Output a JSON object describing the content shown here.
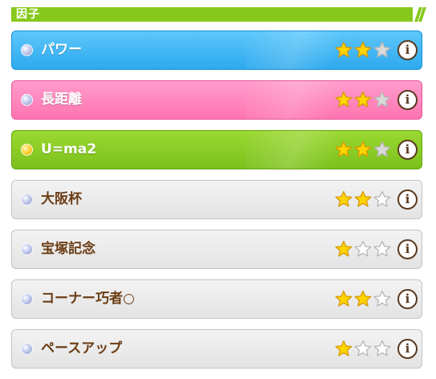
{
  "header": {
    "title": "因子",
    "color": "#86c91c"
  },
  "factors": [
    {
      "name": "パワー",
      "theme": "blue",
      "stars": 2,
      "max_stars": 3,
      "gem": "silver-gem-icon",
      "info": "i"
    },
    {
      "name": "長距離",
      "theme": "pink",
      "stars": 2,
      "max_stars": 3,
      "gem": "silver-gem-icon",
      "info": "i"
    },
    {
      "name": "U=ma2",
      "theme": "green",
      "stars": 2,
      "max_stars": 3,
      "gem": "gold-gem-icon",
      "info": "i"
    },
    {
      "name": "大阪杯",
      "theme": "white",
      "stars": 2,
      "max_stars": 3,
      "gem": "silver-gem-icon",
      "info": "i"
    },
    {
      "name": "宝塚記念",
      "theme": "white",
      "stars": 1,
      "max_stars": 3,
      "gem": "silver-gem-icon",
      "info": "i"
    },
    {
      "name": "コーナー巧者○",
      "theme": "white",
      "stars": 2,
      "max_stars": 3,
      "gem": "silver-gem-icon",
      "info": "i"
    },
    {
      "name": "ペースアップ",
      "theme": "white",
      "stars": 1,
      "max_stars": 3,
      "gem": "silver-gem-icon",
      "info": "i"
    }
  ],
  "colors": {
    "star_filled": "#ffd400",
    "star_filled_edge": "#d79a00",
    "star_on_color_empty": "#d9d9d9",
    "star_on_white_empty": "#ffffff",
    "star_empty_edge": "#b5b5b5",
    "label_dark": "#6b3d15"
  }
}
